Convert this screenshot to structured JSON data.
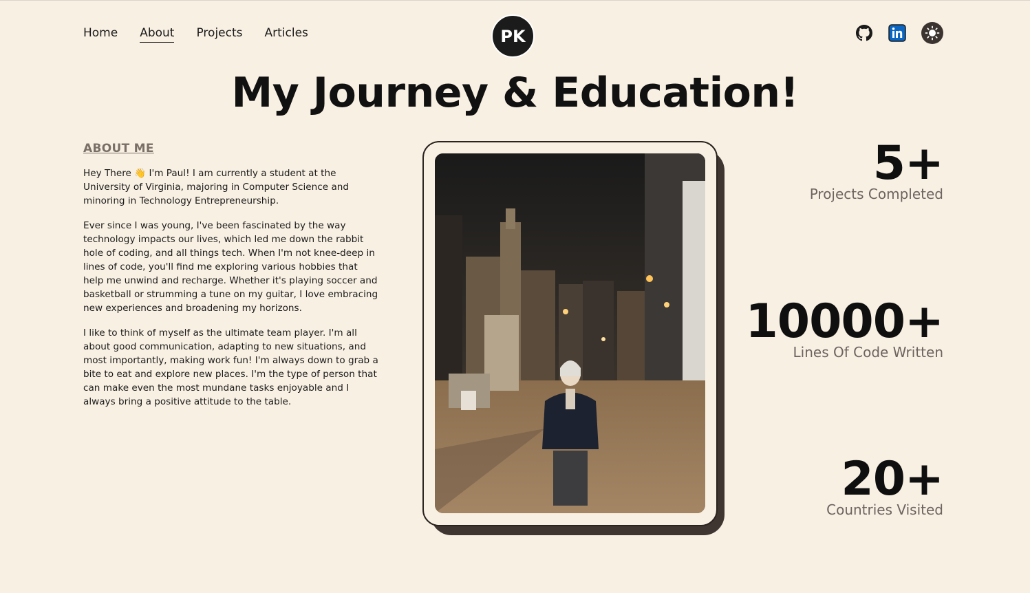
{
  "nav": {
    "links": [
      {
        "label": "Home",
        "active": false
      },
      {
        "label": "About",
        "active": true
      },
      {
        "label": "Projects",
        "active": false
      },
      {
        "label": "Articles",
        "active": false
      }
    ],
    "logo_text": "PK",
    "icons": [
      "github-icon",
      "linkedin-icon",
      "sun-icon"
    ]
  },
  "hero": {
    "title": "My Journey & Education!"
  },
  "about": {
    "heading": "About Me",
    "paragraphs": [
      "Hey There 👋 I'm Paul! I am currently a student at the University of Virginia, majoring in Computer Science and minoring in Technology Entrepreneurship.",
      "Ever since I was young, I've been fascinated by the way technology impacts our lives, which led me down the rabbit hole of coding, and all things tech. When I'm not knee-deep in lines of code, you'll find me exploring various hobbies that help me unwind and recharge. Whether it's playing soccer and basketball or strumming a tune on my guitar, I love embracing new experiences and broadening my horizons.",
      "I like to think of myself as the ultimate team player. I'm all about good communication, adapting to new situations, and most importantly, making work fun! I'm always down to grab a bite to eat and explore new places. I'm the type of person that can make even the most mundane tasks enjoyable and I always bring a positive attitude to the table."
    ]
  },
  "stats": [
    {
      "value": "5+",
      "label": "Projects Completed"
    },
    {
      "value": "10000+",
      "label": "Lines Of Code Written"
    },
    {
      "value": "20+",
      "label": "Countries Visited"
    }
  ],
  "colors": {
    "background": "#f8f0e3",
    "text": "#1b1b1b",
    "muted": "#6d6460",
    "shadow": "#3f3632",
    "linkedin": "#0a66c2"
  }
}
